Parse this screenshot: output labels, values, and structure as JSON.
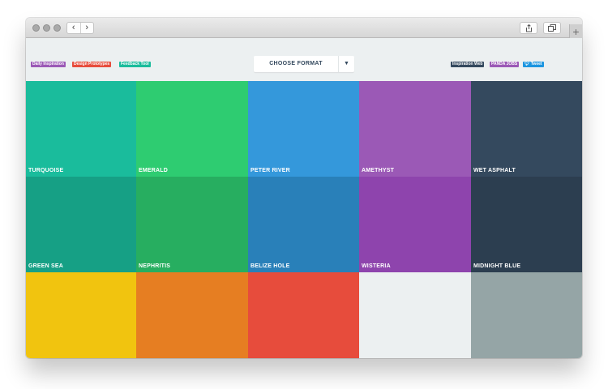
{
  "header": {
    "left_tags": [
      {
        "label": "Daily Inspiration",
        "color": "#9b59b6"
      },
      {
        "label": "Design Prototypes",
        "color": "#e74c3c"
      },
      {
        "label": "Feedback Tool",
        "color": "#1abc9c"
      }
    ],
    "format_button": {
      "label": "CHOOSE FORMAT",
      "caret": "▼"
    },
    "right_tags": [
      {
        "label": "Inspiration Web",
        "color": "#34495e"
      },
      {
        "label": "PANDA JOBS",
        "color": "#9b59b6"
      },
      {
        "label": "Tweet",
        "color": "#1b95e0"
      }
    ]
  },
  "toolbar": {
    "back_glyph": "‹",
    "forward_glyph": "›",
    "new_tab_glyph": "+"
  },
  "palette": [
    {
      "name": "TURQUOISE",
      "color": "#1abc9c"
    },
    {
      "name": "EMERALD",
      "color": "#2ecc71"
    },
    {
      "name": "PETER RIVER",
      "color": "#3498db"
    },
    {
      "name": "AMETHYST",
      "color": "#9b59b6"
    },
    {
      "name": "WET ASPHALT",
      "color": "#34495e"
    },
    {
      "name": "GREEN SEA",
      "color": "#16a085"
    },
    {
      "name": "NEPHRITIS",
      "color": "#27ae60"
    },
    {
      "name": "BELIZE HOLE",
      "color": "#2980b9"
    },
    {
      "name": "WISTERIA",
      "color": "#8e44ad"
    },
    {
      "name": "MIDNIGHT BLUE",
      "color": "#2c3e50"
    },
    {
      "name": "",
      "color": "#f1c40f"
    },
    {
      "name": "",
      "color": "#e67e22"
    },
    {
      "name": "",
      "color": "#e74c3c"
    },
    {
      "name": "",
      "color": "#ecf0f1"
    },
    {
      "name": "",
      "color": "#95a5a6"
    }
  ]
}
